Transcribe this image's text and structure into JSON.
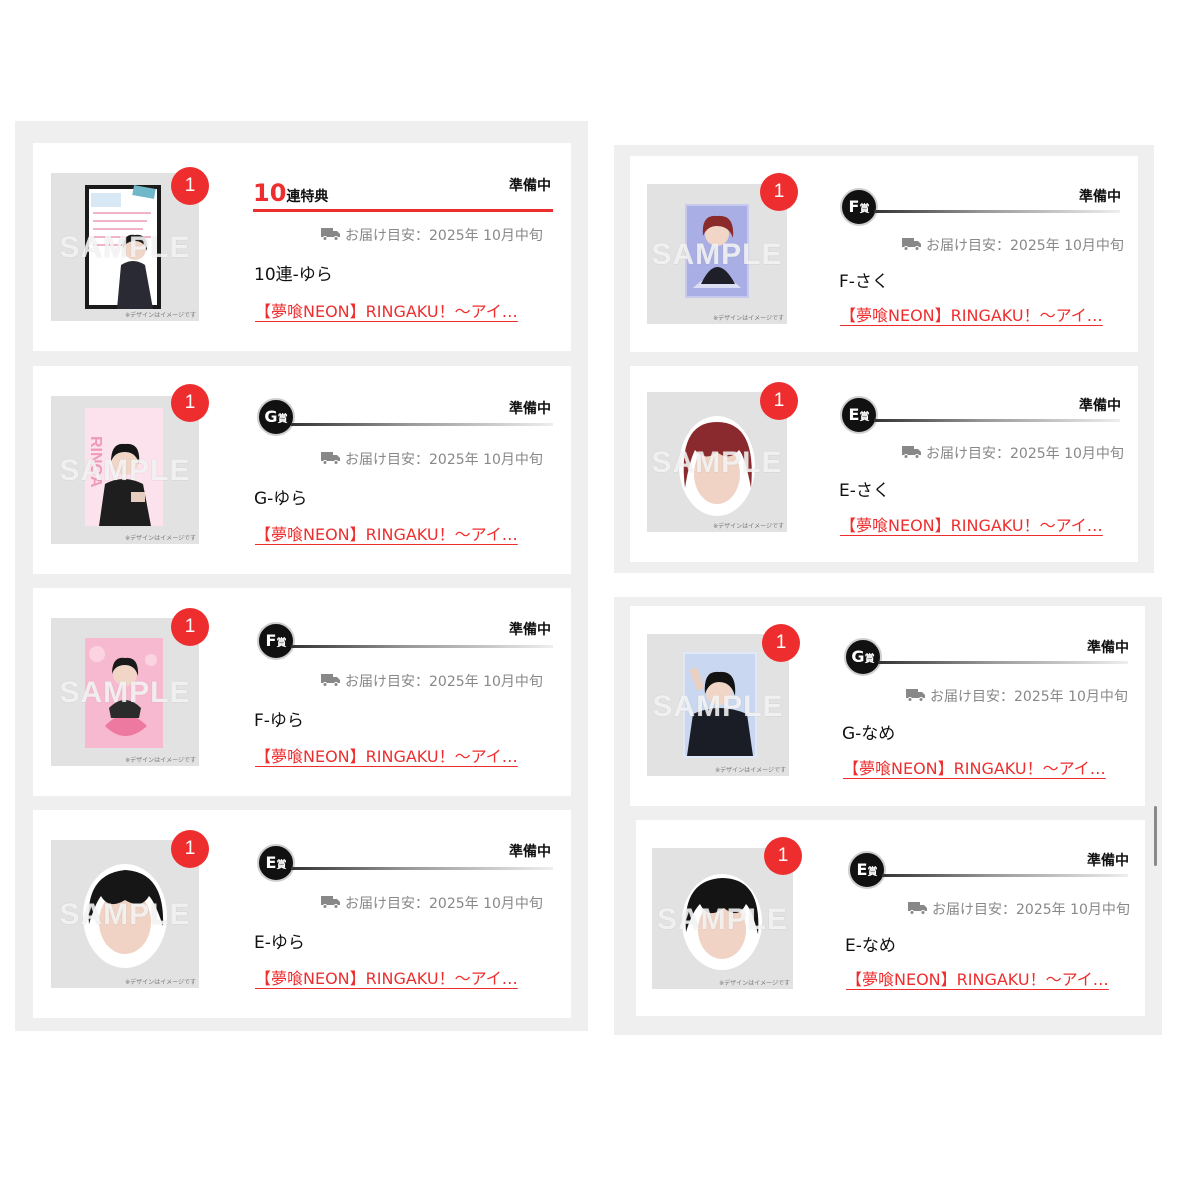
{
  "common": {
    "watermark": "SAMPLE",
    "image_note": "※デザインはイメージです",
    "status": "準備中",
    "delivery": "お届け目安：2025年 10月中旬",
    "link": "【夢喰NEON】RINGAKU！〜アイ…",
    "prize_suffix": "賞",
    "accent_color": "#ee2e2e"
  },
  "left_column": [
    {
      "qty": "1",
      "bonus_number": "10",
      "bonus_label": "連特典",
      "name": "10連-ゆら",
      "icon": "card-portrait"
    },
    {
      "qty": "1",
      "prize": "G",
      "name": "G-ゆら",
      "icon": "photo-card"
    },
    {
      "qty": "1",
      "prize": "F",
      "name": "F-ゆら",
      "icon": "pink-card"
    },
    {
      "qty": "1",
      "prize": "E",
      "name": "E-ゆら",
      "icon": "face-sticker"
    }
  ],
  "right_column_upper": [
    {
      "qty": "1",
      "prize": "F",
      "name": "F-さく",
      "icon": "purple-card"
    },
    {
      "qty": "1",
      "prize": "E",
      "name": "E-さく",
      "icon": "face-sticker-red"
    }
  ],
  "right_column_lower": [
    {
      "qty": "1",
      "prize": "G",
      "name": "G-なめ",
      "icon": "photo-card"
    },
    {
      "qty": "1",
      "prize": "E",
      "name": "E-なめ",
      "icon": "face-sticker"
    }
  ]
}
